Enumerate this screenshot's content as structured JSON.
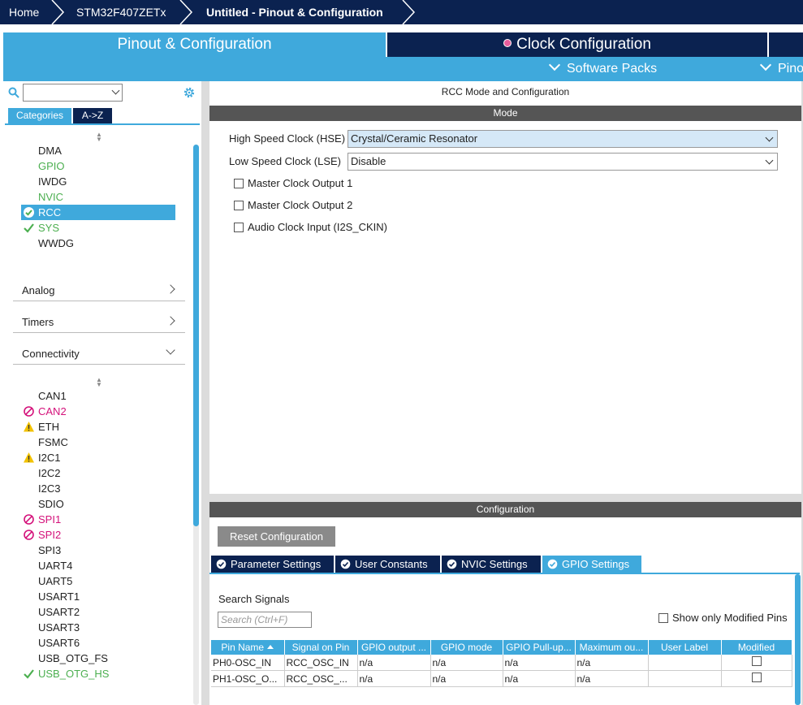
{
  "breadcrumb": {
    "home": "Home",
    "device": "STM32F407ZETx",
    "current": "Untitled - Pinout & Configuration"
  },
  "tabs": {
    "pinout": "Pinout & Configuration",
    "clock": "Clock Configuration",
    "software_packs": "Software Packs",
    "pinout_menu": "Pino"
  },
  "sidebar": {
    "category_tab": "Categories",
    "az_tab": "A->Z",
    "system_core_items": [
      {
        "label": "DMA",
        "state": "normal"
      },
      {
        "label": "GPIO",
        "state": "green"
      },
      {
        "label": "IWDG",
        "state": "normal"
      },
      {
        "label": "NVIC",
        "state": "green"
      },
      {
        "label": "RCC",
        "state": "selected"
      },
      {
        "label": "SYS",
        "state": "green-check"
      },
      {
        "label": "WWDG",
        "state": "normal"
      }
    ],
    "sections": {
      "analog": "Analog",
      "timers": "Timers",
      "connectivity": "Connectivity"
    },
    "connectivity_items": [
      {
        "label": "CAN1",
        "state": "normal"
      },
      {
        "label": "CAN2",
        "state": "disabled"
      },
      {
        "label": "ETH",
        "state": "warning"
      },
      {
        "label": "FSMC",
        "state": "normal"
      },
      {
        "label": "I2C1",
        "state": "warning"
      },
      {
        "label": "I2C2",
        "state": "normal"
      },
      {
        "label": "I2C3",
        "state": "normal"
      },
      {
        "label": "SDIO",
        "state": "normal"
      },
      {
        "label": "SPI1",
        "state": "disabled"
      },
      {
        "label": "SPI2",
        "state": "disabled"
      },
      {
        "label": "SPI3",
        "state": "normal"
      },
      {
        "label": "UART4",
        "state": "normal"
      },
      {
        "label": "UART5",
        "state": "normal"
      },
      {
        "label": "USART1",
        "state": "normal"
      },
      {
        "label": "USART2",
        "state": "normal"
      },
      {
        "label": "USART3",
        "state": "normal"
      },
      {
        "label": "USART6",
        "state": "normal"
      },
      {
        "label": "USB_OTG_FS",
        "state": "normal"
      },
      {
        "label": "USB_OTG_HS",
        "state": "green-check"
      }
    ]
  },
  "rcc": {
    "title": "RCC Mode and Configuration",
    "mode_header": "Mode",
    "hse_label": "High Speed Clock (HSE)",
    "hse_value": "Crystal/Ceramic Resonator",
    "lse_label": "Low Speed Clock (LSE)",
    "lse_value": "Disable",
    "mco1": "Master Clock Output 1",
    "mco2": "Master Clock Output 2",
    "audio": "Audio Clock Input (I2S_CKIN)"
  },
  "configuration": {
    "header": "Configuration",
    "reset_button": "Reset Configuration",
    "tabs": [
      "Parameter Settings",
      "User Constants",
      "NVIC Settings",
      "GPIO Settings"
    ],
    "search_label": "Search Signals",
    "search_placeholder": "Search (Ctrl+F)",
    "show_modified": "Show only Modified Pins",
    "table": {
      "headers": [
        "Pin Name",
        "Signal on Pin",
        "GPIO output ...",
        "GPIO mode",
        "GPIO Pull-up...",
        "Maximum ou...",
        "User Label",
        "Modified"
      ],
      "rows": [
        [
          "PH0-OSC_IN",
          "RCC_OSC_IN",
          "n/a",
          "n/a",
          "n/a",
          "n/a",
          "",
          ""
        ],
        [
          "PH1-OSC_O...",
          "RCC_OSC_...",
          "n/a",
          "n/a",
          "n/a",
          "n/a",
          "",
          ""
        ]
      ]
    }
  },
  "colors": {
    "navy": "#0b2250",
    "accent": "#3fa9dc",
    "green": "#4caf50",
    "magenta": "#d4117a",
    "warning": "#f2c200"
  },
  "icons": {
    "search": "search-icon",
    "gear": "gear-icon",
    "check": "check-icon",
    "disabled": "disabled-icon",
    "warning": "warning-icon"
  }
}
